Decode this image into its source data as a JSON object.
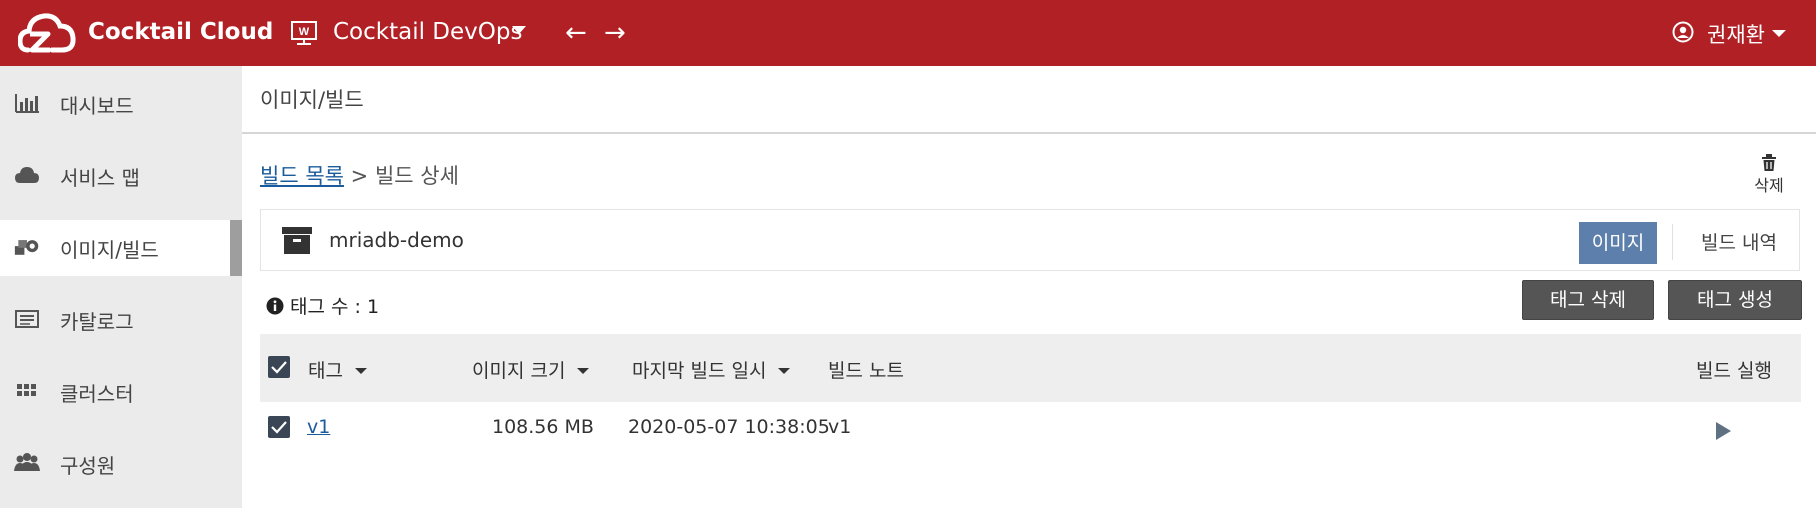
{
  "header": {
    "brand": "Cocktail Cloud",
    "workspace": "Cocktail DevOps",
    "back_icon": "←",
    "forward_icon": "→",
    "user_name": "권재환",
    "brand_color": "#b12024"
  },
  "sidebar": {
    "items": [
      {
        "label": "대시보드",
        "icon": "bar-chart-icon"
      },
      {
        "label": "서비스 맵",
        "icon": "cloud-icon"
      },
      {
        "label": "이미지/빌드",
        "icon": "gears-icon",
        "active": true
      },
      {
        "label": "카탈로그",
        "icon": "catalog-icon"
      },
      {
        "label": "클러스터",
        "icon": "grid-icon"
      },
      {
        "label": "구성원",
        "icon": "users-icon"
      }
    ]
  },
  "page": {
    "title": "이미지/빌드",
    "breadcrumb_link": "빌드 목록",
    "breadcrumb_separator": ">",
    "breadcrumb_current": "빌드 상세",
    "delete_label": "삭제"
  },
  "build": {
    "name": "mriadb-demo",
    "tab_image": "이미지",
    "tab_history": "빌드 내역",
    "tag_count_label": "태그 수 : 1",
    "btn_delete_tag": "태그 삭제",
    "btn_create_tag": "태그 생성"
  },
  "table": {
    "columns": {
      "tag": "태그",
      "image_size": "이미지 크기",
      "last_build": "마지막 빌드 일시",
      "build_note": "빌드 노트",
      "run_build": "빌드 실행"
    },
    "rows": [
      {
        "tag": "v1",
        "size": "108.56 MB",
        "last_build": "2020-05-07 10:38:05",
        "note": "v1"
      }
    ]
  }
}
